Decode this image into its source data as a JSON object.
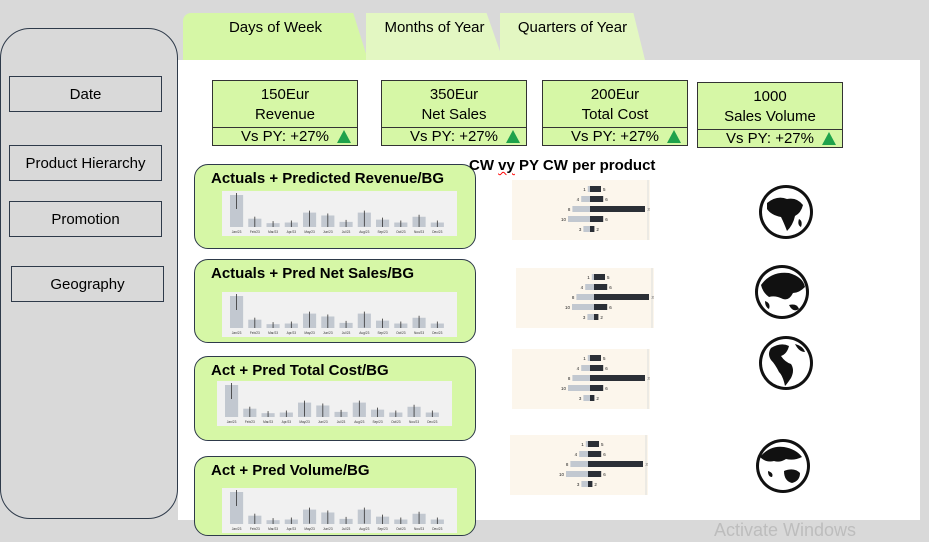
{
  "tabs": [
    {
      "label": "Days of Week",
      "active": true
    },
    {
      "label": "Months of Year",
      "active": false
    },
    {
      "label": "Quarters of Year",
      "active": false
    }
  ],
  "sidebar": {
    "buttons": [
      {
        "label": "Date"
      },
      {
        "label": "Product Hierarchy"
      },
      {
        "label": "Promotion"
      },
      {
        "label": "Geography"
      }
    ]
  },
  "kpis": [
    {
      "value": "150Eur",
      "label": "Revenue",
      "py": "Vs PY: +27%"
    },
    {
      "value": "350Eur",
      "label": "Net Sales",
      "py": "Vs PY: +27%"
    },
    {
      "value": "200Eur",
      "label": "Total Cost",
      "py": "Vs PY: +27%"
    },
    {
      "value": "1000",
      "label": "Sales Volume",
      "py": "Vs PY: +27%"
    }
  ],
  "cards": [
    {
      "title": "Actuals + Predicted Revenue/BG"
    },
    {
      "title": "Actuals + Pred Net Sales/BG"
    },
    {
      "title": "Act + Pred Total Cost/BG"
    },
    {
      "title": "Act + Pred Volume/BG"
    }
  ],
  "cw_title_prefix": "CW ",
  "cw_title_squiggle": "vy",
  "cw_title_suffix": " PY CW per product",
  "colors": {
    "accent_green": "#d6f7a6",
    "up_arrow": "#1fa24b",
    "bar_light": "#c2c8d0",
    "bar_dark": "#2b2f36"
  },
  "icons": [
    "globe-africa-icon",
    "globe-asia-icon",
    "globe-americas-icon",
    "globe-oceania-icon"
  ],
  "watermark": "Activate Windows",
  "chart_data": [
    {
      "type": "bar",
      "categories": [
        "Jan/23",
        "Feb/23",
        "Mar/23",
        "Apr/23",
        "May/23",
        "Jun/23",
        "Jul/23",
        "Aug/23",
        "Sep/23",
        "Oct/23",
        "Nov/23",
        "Dec/23"
      ],
      "values": [
        10,
        2.6,
        1.2,
        1.4,
        4.5,
        3.6,
        1.6,
        4.5,
        2.3,
        1.4,
        3.2,
        1.4
      ]
    },
    {
      "type": "bar",
      "left": [
        1,
        4,
        8,
        10,
        3
      ],
      "right": [
        5,
        6,
        25,
        6,
        2
      ]
    }
  ]
}
